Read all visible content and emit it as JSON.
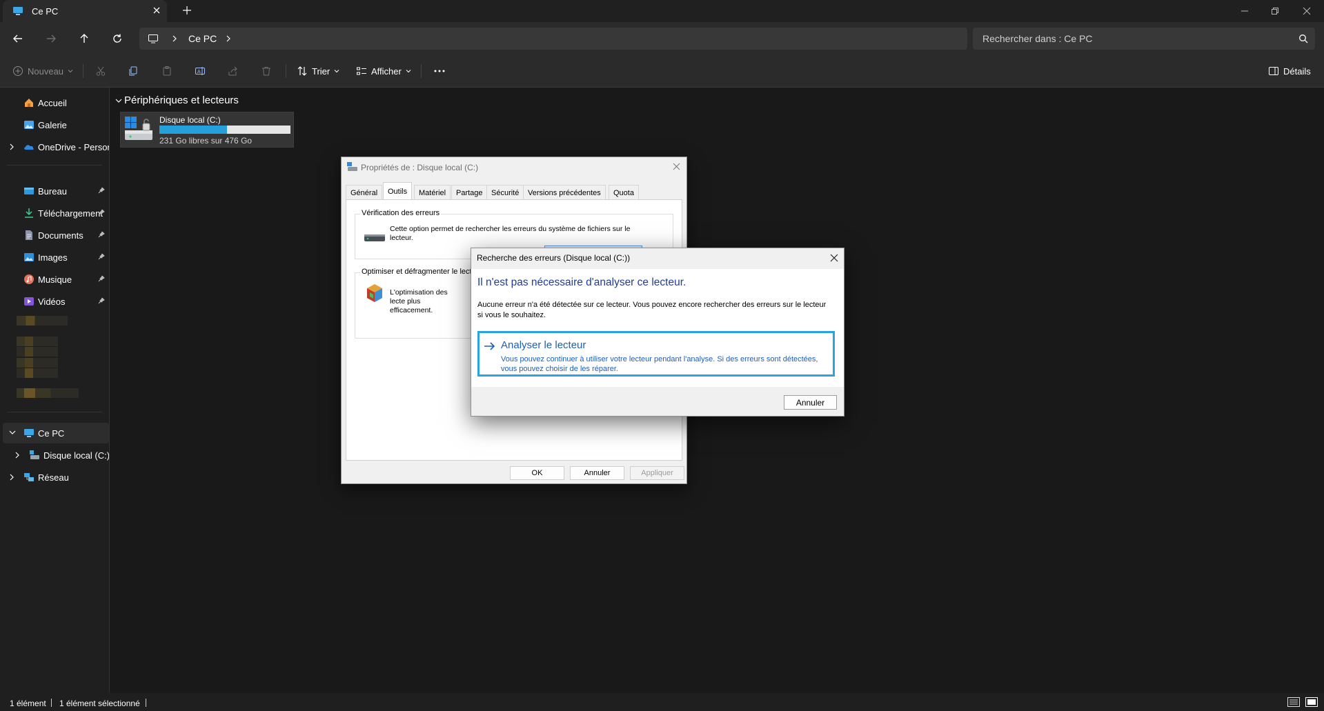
{
  "window": {
    "tab_title": "Ce PC",
    "new_tab_symbol": "+"
  },
  "address": {
    "breadcrumb_current": "Ce PC",
    "search_placeholder": "Rechercher dans : Ce PC"
  },
  "toolbar": {
    "new_label": "Nouveau",
    "sort_label": "Trier",
    "view_label": "Afficher",
    "details_label": "Détails"
  },
  "sidebar": {
    "items": [
      {
        "label": "Accueil",
        "icon": "home-icon"
      },
      {
        "label": "Galerie",
        "icon": "gallery-icon"
      },
      {
        "label": "OneDrive - Persona",
        "icon": "onedrive-icon"
      },
      {
        "label": "Bureau",
        "icon": "desktop-folder-icon"
      },
      {
        "label": "Téléchargement",
        "icon": "downloads-icon"
      },
      {
        "label": "Documents",
        "icon": "documents-icon"
      },
      {
        "label": "Images",
        "icon": "pictures-icon"
      },
      {
        "label": "Musique",
        "icon": "music-icon"
      },
      {
        "label": "Vidéos",
        "icon": "videos-icon"
      },
      {
        "label": "Ce PC",
        "icon": "computer-icon"
      },
      {
        "label": "Disque local (C:)",
        "icon": "drive-icon"
      },
      {
        "label": "Réseau",
        "icon": "network-icon"
      }
    ]
  },
  "content": {
    "section_title": "Périphériques et lecteurs",
    "drive": {
      "name": "Disque local (C:)",
      "space": "231 Go libres sur 476 Go",
      "used_fraction": 0.515,
      "bar_color": "#26a0da"
    }
  },
  "properties": {
    "title": "Propriétés de : Disque local (C:)",
    "tabs": [
      "Général",
      "Outils",
      "Matériel",
      "Partage",
      "Sécurité",
      "Versions précédentes",
      "Quota"
    ],
    "active_tab": "Outils",
    "error_group_title": "Vérification des erreurs",
    "error_group_text": "Cette option permet de rechercher les erreurs du système de fichiers sur le lecteur.",
    "optimize_group_title": "Optimiser et défragmenter le lecte",
    "optimize_group_text": "L'optimisation des lecte plus efficacement.",
    "ok": "OK",
    "cancel": "Annuler",
    "apply": "Appliquer"
  },
  "error_dialog": {
    "title": "Recherche des erreurs (Disque local (C:))",
    "heading": "Il n'est pas nécessaire d'analyser ce lecteur.",
    "message": "Aucune erreur n'a été détectée sur ce lecteur. Vous pouvez encore rechercher des erreurs sur le lecteur si vous le souhaitez.",
    "scan_title": "Analyser le lecteur",
    "scan_desc": "Vous pouvez continuer à utiliser votre lecteur pendant l'analyse. Si des erreurs sont détectées, vous pouvez choisir de les réparer.",
    "cancel": "Annuler"
  },
  "status": {
    "count": "1 élément",
    "selected": "1 élément sélectionné"
  },
  "colors": {
    "accent": "#26a0da",
    "link_blue": "#1e5eb8",
    "heading_blue": "#1e3c96",
    "focus_border": "#29a3e1"
  }
}
